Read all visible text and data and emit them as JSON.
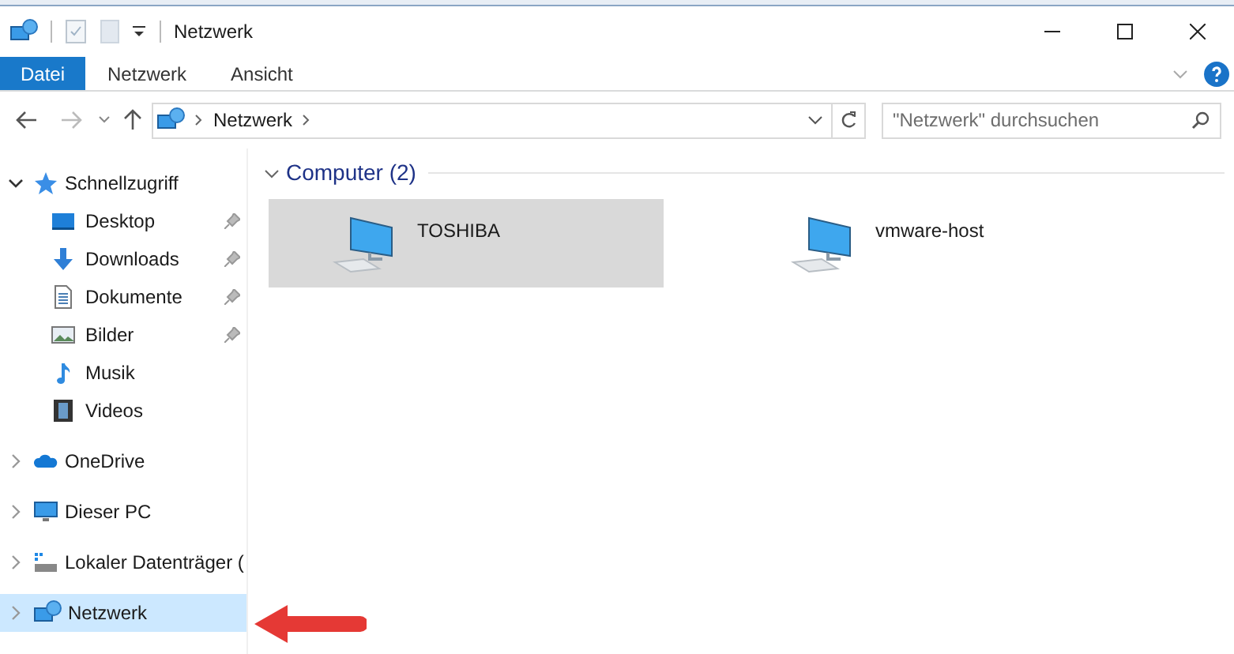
{
  "window": {
    "title": "Netzwerk"
  },
  "ribbon": {
    "tabs": [
      {
        "label": "Datei",
        "selected": true
      },
      {
        "label": "Netzwerk",
        "selected": false
      },
      {
        "label": "Ansicht",
        "selected": false
      }
    ]
  },
  "address_bar": {
    "path": [
      "Netzwerk"
    ]
  },
  "search": {
    "placeholder": "\"Netzwerk\" durchsuchen"
  },
  "nav": [
    {
      "label": "Schnellzugriff",
      "kind": "star",
      "expanded": true,
      "selected": false,
      "children": [
        {
          "label": "Desktop",
          "kind": "desktop",
          "pinned": true,
          "selected": false
        },
        {
          "label": "Downloads",
          "kind": "download",
          "pinned": true,
          "selected": false
        },
        {
          "label": "Dokumente",
          "kind": "document",
          "pinned": true,
          "selected": false
        },
        {
          "label": "Bilder",
          "kind": "image",
          "pinned": true,
          "selected": false
        },
        {
          "label": "Musik",
          "kind": "music",
          "pinned": false,
          "selected": false
        },
        {
          "label": "Videos",
          "kind": "video",
          "pinned": false,
          "selected": false
        }
      ]
    },
    {
      "label": "OneDrive",
      "kind": "cloud",
      "expanded": false,
      "selected": false
    },
    {
      "label": "Dieser PC",
      "kind": "pc",
      "expanded": false,
      "selected": false
    },
    {
      "label": "Lokaler Datenträger (",
      "kind": "drive",
      "expanded": false,
      "selected": false
    },
    {
      "label": "Netzwerk",
      "kind": "network",
      "expanded": false,
      "selected": true
    }
  ],
  "group": {
    "label": "Computer (2)",
    "expanded": true,
    "items": [
      {
        "label": "TOSHIBA",
        "selected": true
      },
      {
        "label": "vmware-host",
        "selected": false
      }
    ]
  }
}
